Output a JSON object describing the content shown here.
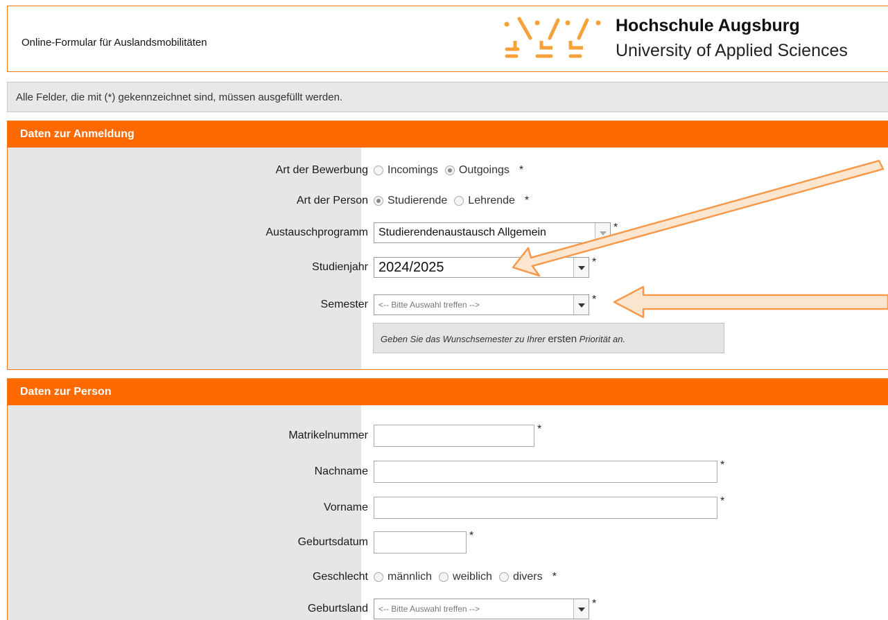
{
  "header": {
    "title": "Online-Formular für Auslandsmobilitäten",
    "brand_name": "Hochschule Augsburg",
    "brand_sub": "University of Applied Sciences"
  },
  "notice": "Alle Felder, die mit (*) gekennzeichnet sind, müssen ausgefüllt werden.",
  "required_mark": "*",
  "anmeldung": {
    "heading": "Daten zur Anmeldung",
    "art_bewerbung": {
      "label": "Art der Bewerbung",
      "options": [
        "Incomings",
        "Outgoings"
      ],
      "selected": "Outgoings"
    },
    "art_person": {
      "label": "Art der Person",
      "options": [
        "Studierende",
        "Lehrende"
      ],
      "selected": "Studierende"
    },
    "austauschprogramm": {
      "label": "Austauschprogramm",
      "value": "Studierendenaustausch Allgemein"
    },
    "studienjahr": {
      "label": "Studienjahr",
      "value": "2024/2025"
    },
    "semester": {
      "label": "Semester",
      "value": "<-- Bitte Auswahl treffen -->"
    },
    "hint": {
      "part1": "Geben Sie das Wunschsemester zu Ihrer ",
      "part2": "ersten",
      "part3": " Priorität an."
    }
  },
  "person": {
    "heading": "Daten zur Person",
    "matrikelnummer": {
      "label": "Matrikelnummer",
      "value": ""
    },
    "nachname": {
      "label": "Nachname",
      "value": ""
    },
    "vorname": {
      "label": "Vorname",
      "value": ""
    },
    "geburtsdatum": {
      "label": "Geburtsdatum",
      "value": ""
    },
    "geschlecht": {
      "label": "Geschlecht",
      "options": [
        "männlich",
        "weiblich",
        "divers"
      ],
      "selected": ""
    },
    "geburtsland": {
      "label": "Geburtsland",
      "value": "<-- Bitte Auswahl treffen -->"
    }
  },
  "colors": {
    "accent": "#ff6a00",
    "border": "#f07a1a",
    "arrow_fill": "#fde6cf",
    "arrow_stroke": "#f59a4c"
  },
  "icons": {
    "logo": "hochschule-augsburg-logo",
    "dropdown": "chevron-down-icon",
    "annotation": "callout-arrow"
  }
}
